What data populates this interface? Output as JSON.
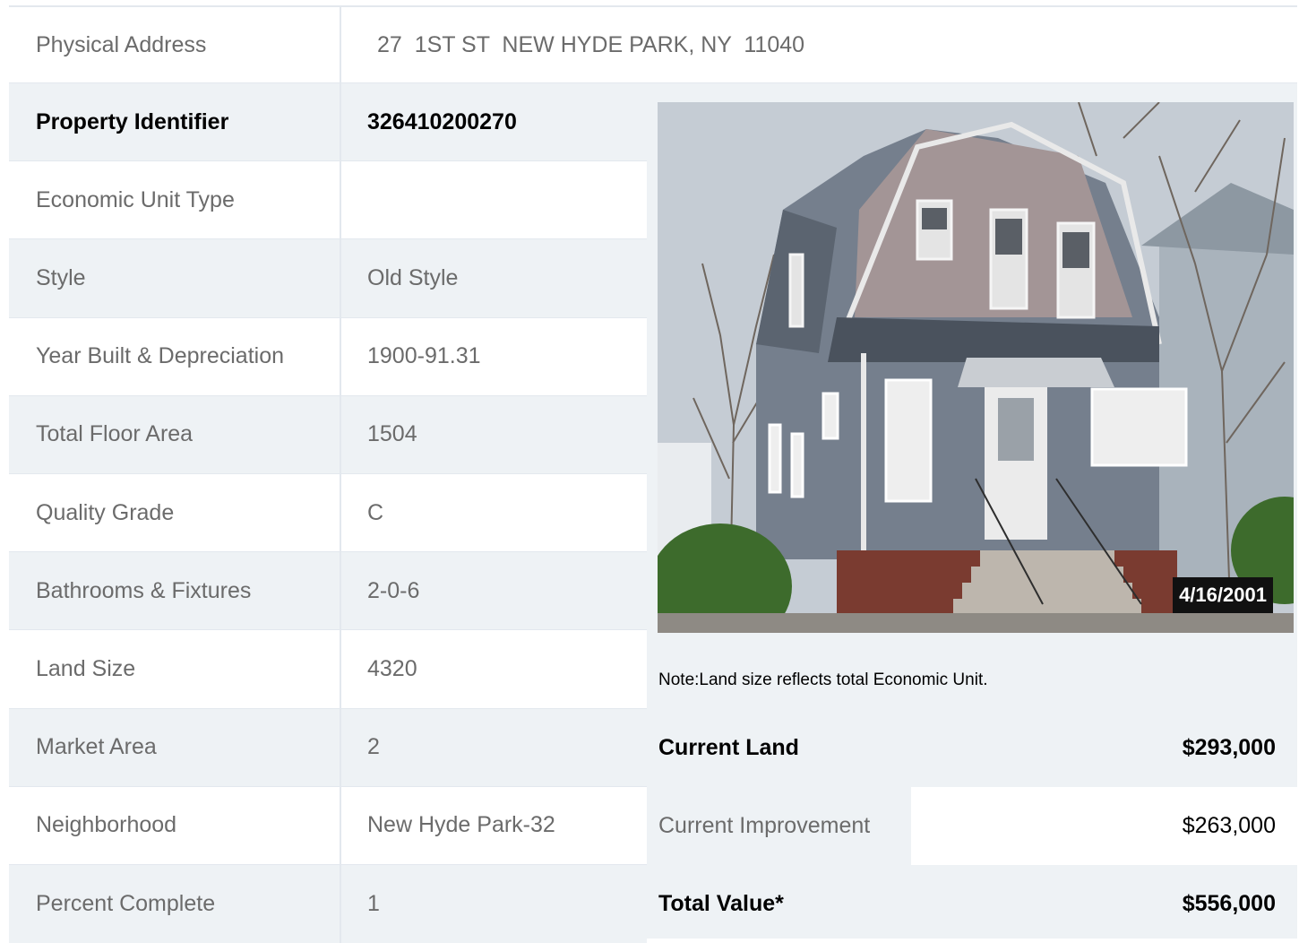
{
  "address": {
    "label": "Physical Address",
    "value": "27  1ST ST  NEW HYDE PARK, NY  11040"
  },
  "details": [
    {
      "label": "Property Identifier",
      "value": "326410200270",
      "bold": true
    },
    {
      "label": "Economic Unit Type",
      "value": ""
    },
    {
      "label": "Style",
      "value": "Old Style"
    },
    {
      "label": "Year Built & Depreciation",
      "value": "1900-91.31"
    },
    {
      "label": "Total Floor Area",
      "value": "1504"
    },
    {
      "label": "Quality Grade",
      "value": "C"
    },
    {
      "label": "Bathrooms & Fixtures",
      "value": "2-0-6"
    },
    {
      "label": "Land Size",
      "value": "4320"
    },
    {
      "label": "Market Area",
      "value": "2"
    },
    {
      "label": "Neighborhood",
      "value": "New Hyde Park-32"
    },
    {
      "label": "Percent Complete",
      "value": "1"
    }
  ],
  "photo": {
    "date_stamp": "4/16/2001"
  },
  "note": "Note:Land size reflects total Economic Unit.",
  "values": [
    {
      "label": "Current Land",
      "value": "$293,000",
      "bold": true
    },
    {
      "label": "Current Improvement",
      "value": "$263,000",
      "bold": false
    },
    {
      "label": "Total Value*",
      "value": "$556,000",
      "bold": true
    }
  ],
  "colors": {
    "shade": "#eef2f5",
    "border": "#e3e8ee",
    "muted_text": "#6b6b6b"
  }
}
